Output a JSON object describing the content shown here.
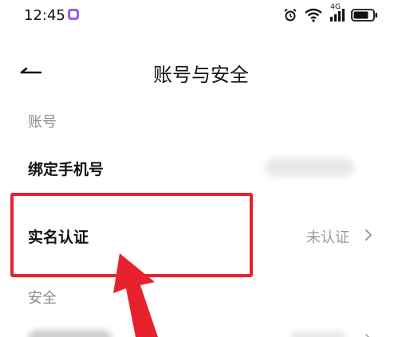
{
  "status_bar": {
    "time": "12:45",
    "network_label": "4G",
    "icons": [
      "app-notification-icon",
      "alarm-icon",
      "wifi-icon",
      "signal-icon",
      "battery-icon"
    ]
  },
  "header": {
    "title": "账号与安全",
    "back_icon": "back-arrow-icon"
  },
  "sections": {
    "account": {
      "label": "账号",
      "rows": {
        "bind_phone": {
          "label": "绑定手机号",
          "value_redacted": true
        },
        "real_name": {
          "label": "实名认证",
          "value": "未认证"
        }
      }
    },
    "security": {
      "label": "安全",
      "rows": {
        "partial": {
          "label": "",
          "value_redacted": true
        }
      }
    }
  },
  "annotation": {
    "highlight_color": "#e8222d",
    "arrow_color": "#e8222d"
  }
}
